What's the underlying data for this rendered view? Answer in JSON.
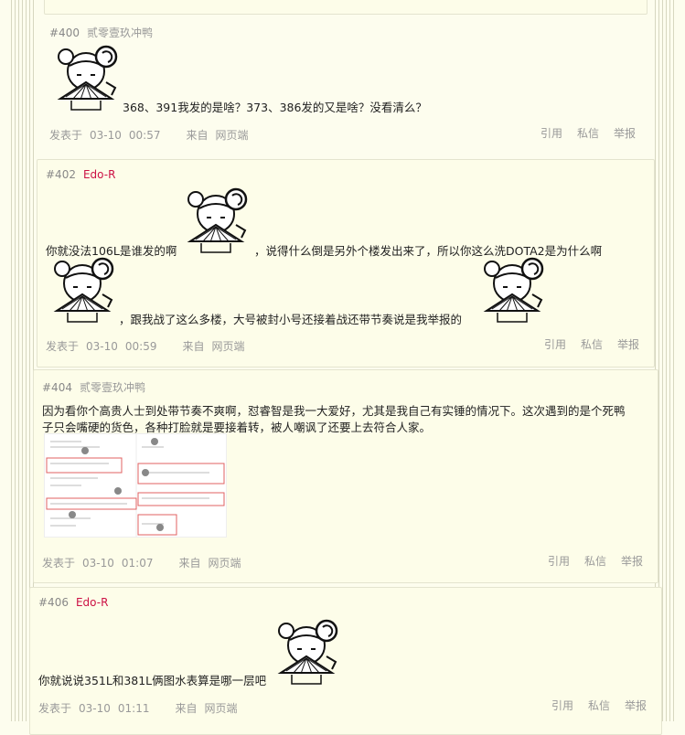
{
  "posts": [
    {
      "floor": "#400",
      "user": "贰零壹玖冲鸭",
      "text": "368、391我发的是啥？373、386发的又是啥？没看清么？",
      "date": "03-10",
      "time": "00:57",
      "source_label": "来自",
      "source": "网页端"
    },
    {
      "floor": "#402",
      "user": "Edo-R",
      "text1": "你就没法106L是谁发的啊",
      "text2": "，说得什么倒是另外个楼发出来了，所以你这么洗DOTA2是为什么啊",
      "text3": "，跟我战了这么多楼，大号被封小号还接着战还带节奏说是我举报的",
      "date": "03-10",
      "time": "00:59",
      "source_label": "来自",
      "source": "网页端"
    },
    {
      "floor": "#404",
      "user": "贰零壹玖冲鸭",
      "text1": "因为看你个高贵人士到处带节奏不爽啊，怼睿智是我一大爱好，尤其是我自己有实锤的情况下。这次遇到的是个死鸭",
      "text2": "子只会嘴硬的货色，各种打脸就是要接着转，被人嘲讽了还要上去符合人家。",
      "date": "03-10",
      "time": "01:07",
      "source_label": "来自",
      "source": "网页端"
    },
    {
      "floor": "#406",
      "user": "Edo-R",
      "text": "你就说说351L和381L俩图水表算是哪一层吧",
      "date": "03-10",
      "time": "01:11",
      "source_label": "来自",
      "source": "网页端"
    }
  ],
  "actions": {
    "quote": "引用",
    "pm": "私信",
    "report": "举报"
  },
  "meta_label": "发表于",
  "colors": {
    "bg": "#fdfdee",
    "user_red": "#cc1144",
    "muted": "#999999"
  }
}
